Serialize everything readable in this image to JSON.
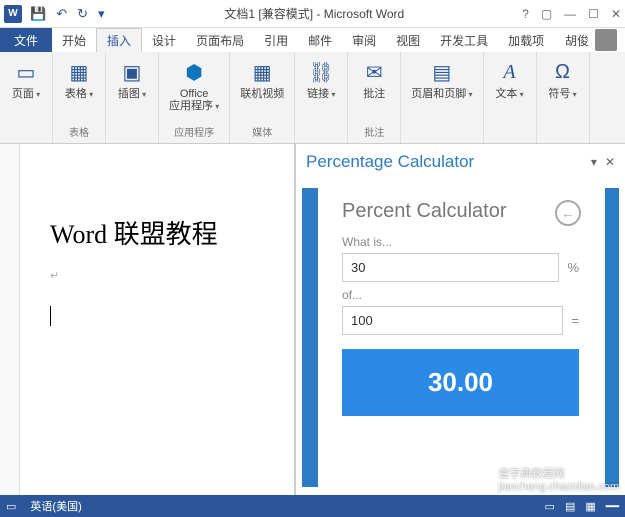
{
  "titlebar": {
    "doc_title": "文档1 [兼容模式] - Microsoft Word"
  },
  "tabs": {
    "file": "文件",
    "items": [
      "开始",
      "插入",
      "设计",
      "页面布局",
      "引用",
      "邮件",
      "审阅",
      "视图",
      "开发工具",
      "加载项"
    ],
    "active_index": 1,
    "user_name": "胡俊"
  },
  "ribbon": {
    "groups": [
      {
        "label": "",
        "buttons": [
          {
            "label": "页面",
            "icon": "▭"
          }
        ]
      },
      {
        "label": "表格",
        "buttons": [
          {
            "label": "表格",
            "icon": "▦"
          }
        ]
      },
      {
        "label": "",
        "buttons": [
          {
            "label": "插图",
            "icon": "▣"
          }
        ]
      },
      {
        "label": "应用程序",
        "buttons": [
          {
            "label": "Office\n应用程序",
            "icon": "⬢"
          }
        ]
      },
      {
        "label": "媒体",
        "buttons": [
          {
            "label": "联机视频",
            "icon": "▦"
          }
        ]
      },
      {
        "label": "",
        "buttons": [
          {
            "label": "链接",
            "icon": "⛓"
          }
        ]
      },
      {
        "label": "批注",
        "buttons": [
          {
            "label": "批注",
            "icon": "✉"
          }
        ]
      },
      {
        "label": "",
        "buttons": [
          {
            "label": "页眉和页脚",
            "icon": "▤"
          }
        ]
      },
      {
        "label": "",
        "buttons": [
          {
            "label": "文本",
            "icon": "A"
          }
        ]
      },
      {
        "label": "",
        "buttons": [
          {
            "label": "符号",
            "icon": "Ω"
          }
        ]
      }
    ]
  },
  "document": {
    "main_text": "Word 联盟教程"
  },
  "taskpane": {
    "title": "Percentage Calculator",
    "card_title": "Percent Calculator",
    "what_is": "What is...",
    "value1": "30",
    "percent": "%",
    "of": "of...",
    "value2": "100",
    "equals": "=",
    "result": "30.00"
  },
  "statusbar": {
    "lang": "英语(美国)"
  },
  "watermark": "查字典教程网\njiaocheng.chazidian.com"
}
